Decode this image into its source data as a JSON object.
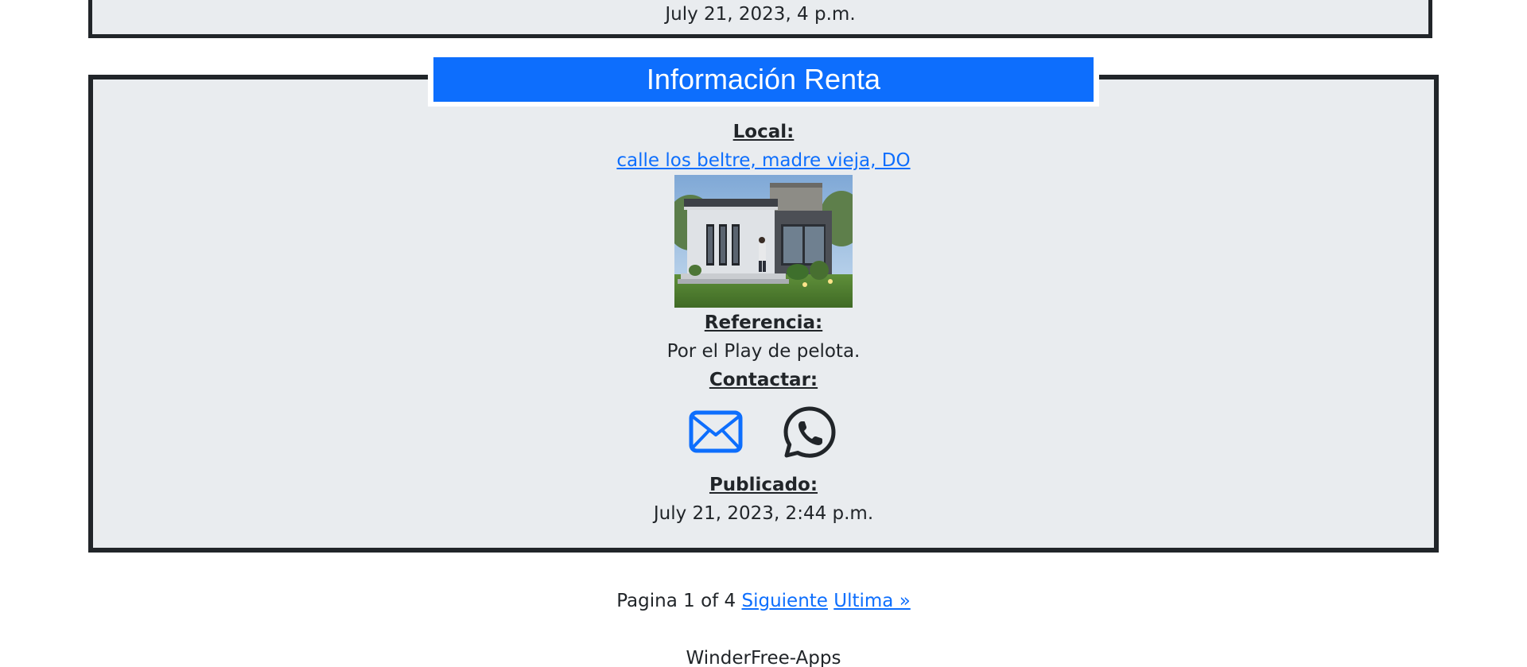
{
  "prev_card": {
    "date": "July 21, 2023, 4 p.m."
  },
  "card": {
    "header_title": "Información Renta",
    "local_label": "Local:",
    "local_value": "calle los beltre, madre vieja, DO",
    "reference_label": "Referencia:",
    "reference_value": "Por el Play de pelota.",
    "contact_label": "Contactar:",
    "published_label": "Publicado:",
    "published_value": "July 21, 2023, 2:44 p.m.",
    "icons": [
      "envelope-icon",
      "whatsapp-icon"
    ]
  },
  "pagination": {
    "status": "Pagina 1 of 4",
    "next_label": "Siguiente",
    "last_label": "Ultima »"
  },
  "footer": {
    "text": "WinderFree-Apps"
  },
  "colors": {
    "accent": "#0d6efd",
    "card_bg": "#e9ecef",
    "border": "#212529"
  }
}
